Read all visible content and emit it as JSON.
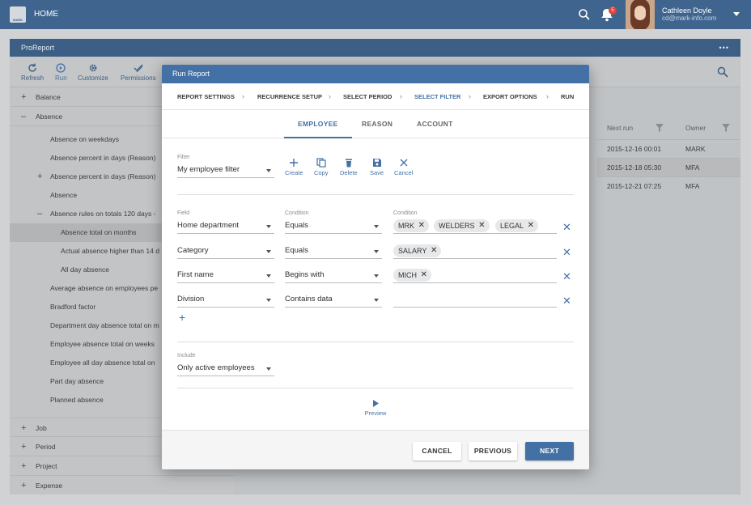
{
  "topbar": {
    "logo_text": "MARK",
    "home": "HOME",
    "notif_count": "5",
    "user_name": "Cathleen Doyle",
    "user_email": "cd@mark-info.com"
  },
  "app": {
    "title": "ProReport",
    "menu": "•••"
  },
  "toolbar": [
    {
      "label": "Refresh",
      "icon": "refresh-icon"
    },
    {
      "label": "Run",
      "icon": "play-icon"
    },
    {
      "label": "Customize",
      "icon": "gear-icon"
    },
    {
      "label": "Permissions",
      "icon": "check-icon"
    }
  ],
  "tree": {
    "groups": {
      "balance": "Balance",
      "absence": "Absence",
      "job": "Job",
      "period": "Period",
      "project": "Project",
      "expense": "Expense"
    },
    "items": [
      "Absence on weekdays",
      "Absence percent in days (Reason)",
      "Absence percent in days (Reason)",
      "Absence",
      "Absence rules on totals 120 days - ",
      "Absence total on months",
      "Actual absence higher than 14 d",
      "All day absence",
      "Average absence on employees pe",
      "Bradford factor",
      "Department day absence total on m",
      "Employee absence total on weeks",
      "Employee all day absence total on",
      "Part day absence",
      "Planned absence"
    ]
  },
  "grid": {
    "headers": [
      "Next run",
      "Owner"
    ],
    "rows": [
      [
        "2015-12-16 00:01",
        "MARK"
      ],
      [
        "2015-12-18 05:30",
        "MFA"
      ],
      [
        "2015-12-21 07:25",
        "MFA"
      ]
    ]
  },
  "modal": {
    "title": "Run Report",
    "steps": [
      "REPORT SETTINGS",
      "RECURRENCE SETUP",
      "SELECT PERIOD",
      "SELECT FILTER",
      "EXPORT OPTIONS",
      "RUN"
    ],
    "tabs": [
      "EMPLOYEE",
      "REASON",
      "ACCOUNT"
    ],
    "filter": {
      "label": "Filter",
      "value": "My employee filter"
    },
    "actions": [
      "Create",
      "Copy",
      "Delete",
      "Save",
      "Cancel"
    ],
    "col_labels": {
      "field": "Field",
      "condition": "Condition",
      "condition2": "Condition"
    },
    "rows": [
      {
        "field": "Home department",
        "condition": "Equals",
        "chips": [
          "MRK",
          "WELDERS",
          "LEGAL"
        ]
      },
      {
        "field": "Category",
        "condition": "Equals",
        "chips": [
          "SALARY"
        ]
      },
      {
        "field": "First name",
        "condition": "Begins with",
        "chips": [
          "MICH"
        ]
      },
      {
        "field": "Division",
        "condition": "Contains data",
        "chips": []
      }
    ],
    "include": {
      "label": "Include",
      "value": "Only active employees"
    },
    "preview": "Preview",
    "buttons": {
      "cancel": "CANCEL",
      "previous": "PREVIOUS",
      "next": "NEXT"
    },
    "accent": "#4471a5"
  }
}
